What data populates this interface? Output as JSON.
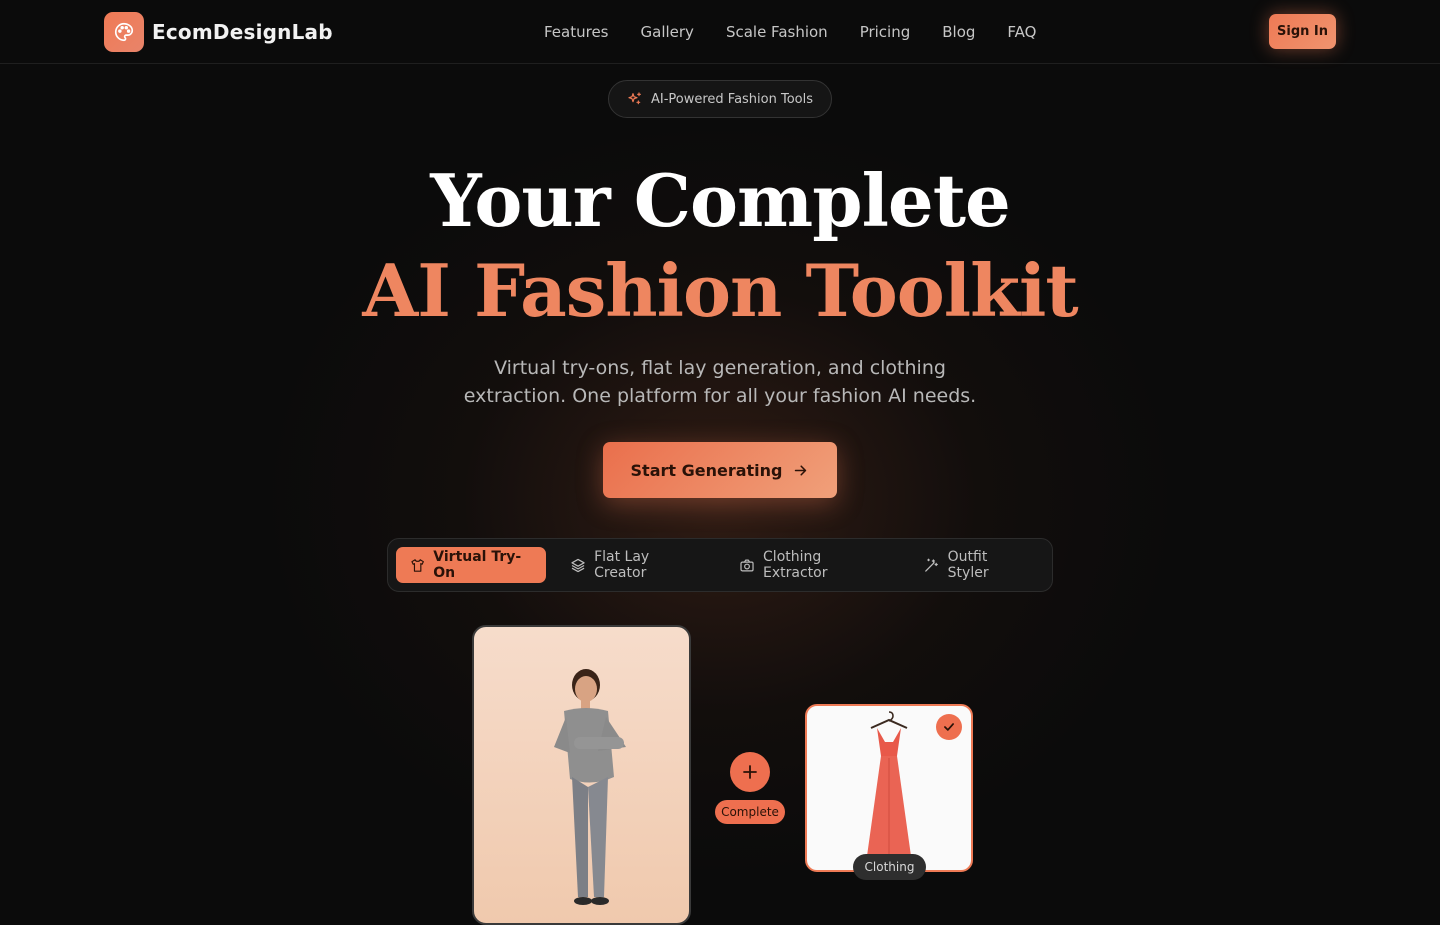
{
  "brand": {
    "name": "EcomDesignLab",
    "logo_icon": "palette-icon"
  },
  "nav": {
    "items": [
      "Features",
      "Gallery",
      "Scale Fashion",
      "Pricing",
      "Blog",
      "FAQ"
    ]
  },
  "header": {
    "signin_label": "Sign In"
  },
  "hero": {
    "badge": "AI-Powered Fashion Tools",
    "title_line1": "Your Complete",
    "title_line2": "AI Fashion Toolkit",
    "subtitle": "Virtual try-ons, flat lay generation, and clothing extraction. One platform for all your fashion AI needs.",
    "cta_label": "Start Generating"
  },
  "tabs": [
    {
      "label": "Virtual Try-On",
      "icon": "shirt-icon",
      "active": true
    },
    {
      "label": "Flat Lay Creator",
      "icon": "layers-icon",
      "active": false
    },
    {
      "label": "Clothing Extractor",
      "icon": "camera-icon",
      "active": false
    },
    {
      "label": "Outfit Styler",
      "icon": "magic-wand-icon",
      "active": false
    }
  ],
  "showcase": {
    "combine_label": "Complete",
    "clothing_label": "Clothing"
  },
  "colors": {
    "accent": "#ee7a55",
    "background": "#0b0b0b",
    "title_accent": "#ee8660"
  }
}
